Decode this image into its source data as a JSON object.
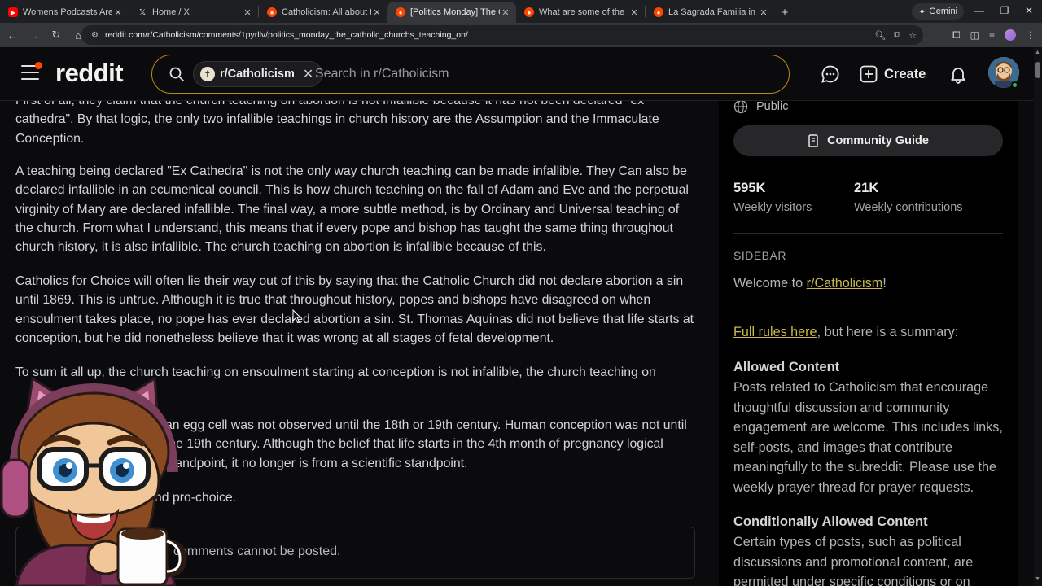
{
  "browser": {
    "tabs": [
      {
        "title": "Womens Podcasts Are A Joke",
        "favicon_color": "#ff0000",
        "active": false
      },
      {
        "title": "Home / X",
        "favicon_color": "#000000",
        "active": false
      },
      {
        "title": "Catholicism: All about the Cath",
        "favicon_color": "#ff4500",
        "active": false
      },
      {
        "title": "[Politics Monday] The Catholic",
        "favicon_color": "#ff4500",
        "active": true
      },
      {
        "title": "What are some of the most be",
        "favicon_color": "#ff4500",
        "active": false
      },
      {
        "title": "La Sagrada Familia in Barcelona",
        "favicon_color": "#ff4500",
        "active": false
      }
    ],
    "gemini_label": "Gemini",
    "url": "reddit.com/r/Catholicism/comments/1pyrllv/politics_monday_the_catholic_churchs_teaching_on/"
  },
  "header": {
    "logo": "reddit",
    "search_chip": "r/Catholicism",
    "search_placeholder": "Search in r/Catholicism",
    "create_label": "Create",
    "accent_color": "#ff4500",
    "search_border_color": "#b98a10"
  },
  "post": {
    "paragraphs": [
      "First of all, they claim that the church teaching on abortion is not infallible because it has not been declared \"ex cathedra\". By that logic, the only two infallible teachings in church history are the Assumption and the Immaculate Conception.",
      "A teaching being declared \"Ex Cathedra\" is not the only way church teaching can be made infallible. They Can also be declared infallible in an ecumenical council. This is how church teaching on the fall of Adam and Eve and the perpetual virginity of Mary are declared infallible. The final way, a more subtle method, is by Ordinary and Universal teaching of the church. From what I understand, this means that if every pope and bishop has taught the same thing throughout church history, it is also infallible. The church teaching on abortion is infallible because of this.",
      "Catholics for Choice will often lie their way out of this by saying that the Catholic Church did not declare abortion a sin until 1869. This is untrue. Although it is true that throughout history, popes and bishops have disagreed on when ensoulment takes place, no pope has ever declared abortion a sin. St. Thomas Aquinas did not believe that life starts at conception, but he did nonetheless believe that it was wrong at all stages of fetal development.",
      "To sum it all up, the church teaching on ensoulment starting at conception is not infallible, the church teaching on",
      "an egg cell was not observed until the 18th or 19th century. Human conception was not until the 19th century. Although the belief that life starts in the 4th month of pregnancy logical standpoint, it no longer is from a scientific standpoint.",
      "nd pro-choice."
    ],
    "notice": "comments cannot be posted."
  },
  "sidebar": {
    "visibility": "Public",
    "guide_label": "Community Guide",
    "stats": [
      {
        "value": "595K",
        "label": "Weekly visitors"
      },
      {
        "value": "21K",
        "label": "Weekly contributions"
      }
    ],
    "heading": "SIDEBAR",
    "welcome_prefix": "Welcome to ",
    "welcome_link": "r/Catholicism",
    "welcome_suffix": "!",
    "rules_link": "Full rules here",
    "rules_suffix": ", but here is a summary:",
    "sections": [
      {
        "title": "Allowed Content",
        "text": "Posts related to Catholicism that encourage thoughtful discussion and community engagement are welcome. This includes links, self-posts, and images that contribute meaningfully to the subreddit. Please use the weekly prayer thread for prayer requests."
      },
      {
        "title": "Conditionally Allowed Content",
        "text": "Certain types of posts, such as political discussions and promotional content, are permitted under specific conditions or on"
      }
    ]
  }
}
